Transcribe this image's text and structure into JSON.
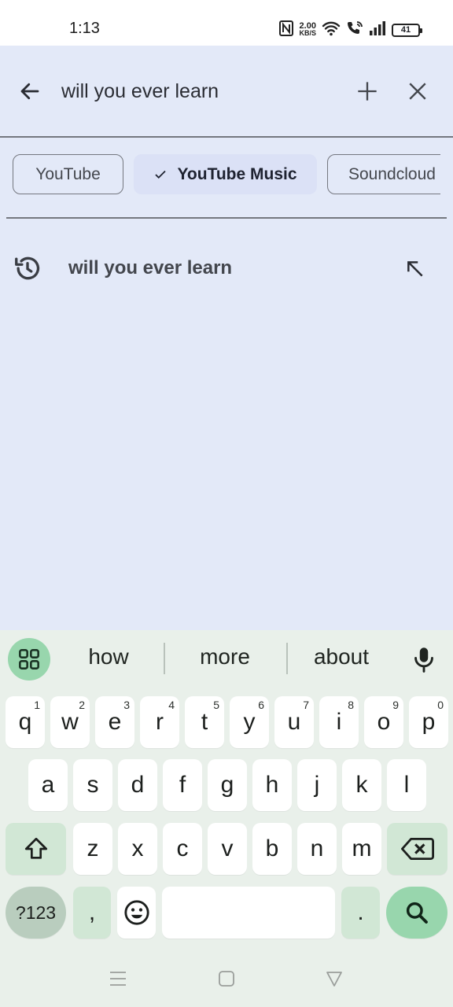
{
  "status_bar": {
    "time": "1:13",
    "net_speed_value": "2.00",
    "net_speed_unit": "KB/S",
    "battery": "41"
  },
  "search": {
    "query": "will you ever learn"
  },
  "chips": [
    {
      "label": "YouTube",
      "selected": false
    },
    {
      "label": "YouTube Music",
      "selected": true
    },
    {
      "label": "Soundcloud",
      "selected": false
    }
  ],
  "suggestions": [
    {
      "text": "will you ever learn",
      "icon": "history-icon",
      "action_icon": "arrow-up-left-icon"
    }
  ],
  "keyboard": {
    "word_suggestions": [
      "how",
      "more",
      "about"
    ],
    "row1": [
      {
        "key": "q",
        "hint": "1"
      },
      {
        "key": "w",
        "hint": "2"
      },
      {
        "key": "e",
        "hint": "3"
      },
      {
        "key": "r",
        "hint": "4"
      },
      {
        "key": "t",
        "hint": "5"
      },
      {
        "key": "y",
        "hint": "6"
      },
      {
        "key": "u",
        "hint": "7"
      },
      {
        "key": "i",
        "hint": "8"
      },
      {
        "key": "o",
        "hint": "9"
      },
      {
        "key": "p",
        "hint": "0"
      }
    ],
    "row2": [
      "a",
      "s",
      "d",
      "f",
      "g",
      "h",
      "j",
      "k",
      "l"
    ],
    "row3": [
      "z",
      "x",
      "c",
      "v",
      "b",
      "n",
      "m"
    ],
    "symbols_label": "?123",
    "comma_label": ",",
    "period_label": "."
  },
  "colors": {
    "background": "#e3e9f8",
    "selected_chip": "#dbe1f6",
    "keyboard_bg": "#e9f0ea",
    "keyboard_accent": "#98d6ad"
  }
}
